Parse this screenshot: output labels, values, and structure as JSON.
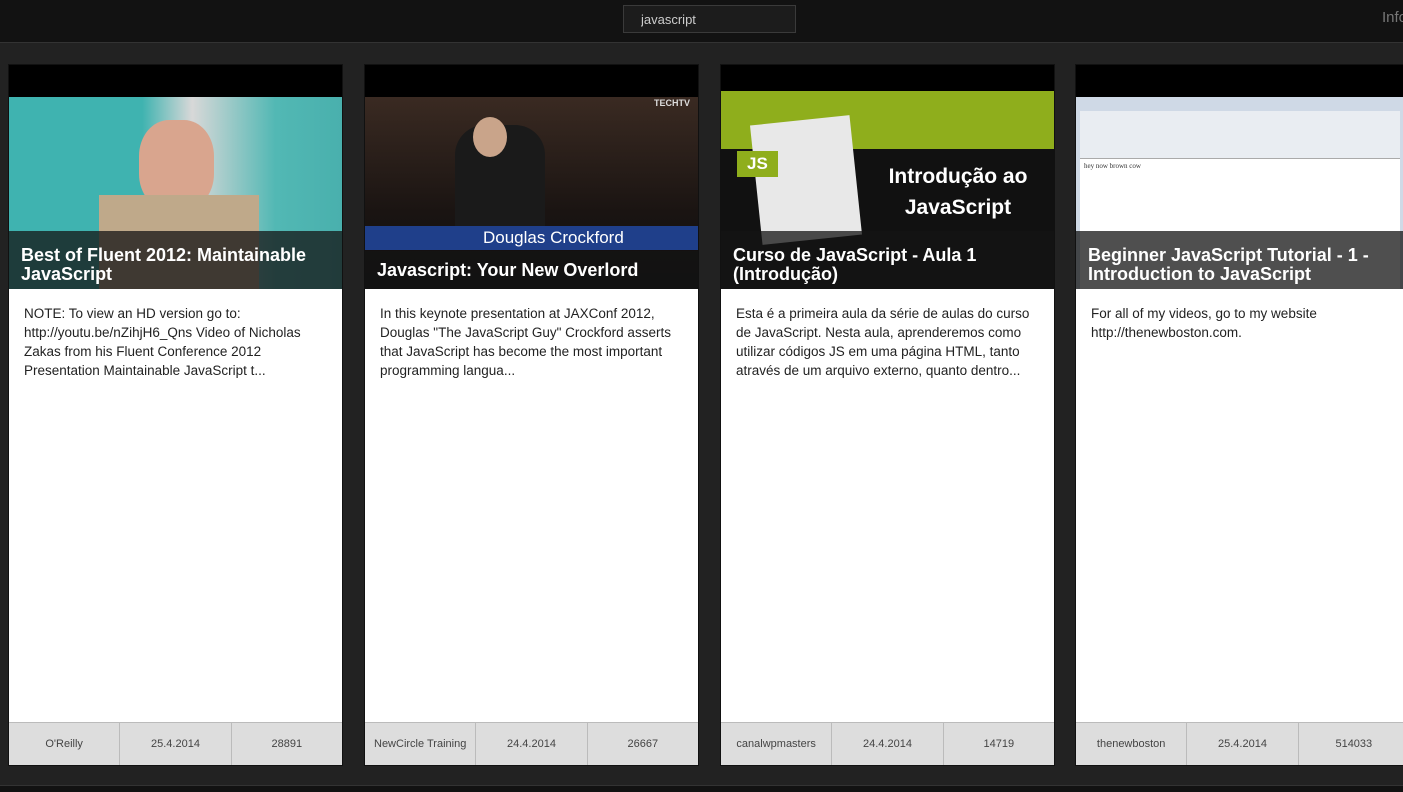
{
  "search": {
    "value": "javascript"
  },
  "header": {
    "info_label": "Info"
  },
  "cards": [
    {
      "title": "Best of Fluent 2012: Maintainable JavaScript",
      "description": "NOTE: To view an HD version go to: http://youtu.be/nZihjH6_Qns Video of Nicholas Zakas from his Fluent Conference 2012 Presentation Maintainable JavaScript t...",
      "channel": "O'Reilly",
      "date": "25.4.2014",
      "views": "28891"
    },
    {
      "title": "Javascript: Your New Overlord",
      "description": "In this keynote presentation at JAXConf 2012, Douglas \"The JavaScript Guy\" Crockford asserts that JavaScript has become the most important programming langua...",
      "channel": "NewCircle Training",
      "date": "24.4.2014",
      "views": "26667",
      "thumb_text": "Douglas Crockford",
      "thumb_logo": "TECHTV"
    },
    {
      "title": "Curso de JavaScript - Aula 1 (Introdução)",
      "description": "Esta é a primeira aula da série de aulas do curso de JavaScript. Nesta aula, aprenderemos como utilizar códigos JS em uma página HTML, tanto através de um arquivo externo, quanto dentro...",
      "channel": "canalwpmasters",
      "date": "24.4.2014",
      "views": "14719",
      "thumb_text": "Introdução ao JavaScript",
      "thumb_badge": "JS"
    },
    {
      "title": "Beginner JavaScript Tutorial - 1 - Introduction to JavaScript",
      "description": "For all of my videos, go to my website http://thenewboston.com.",
      "channel": "thenewboston",
      "date": "25.4.2014",
      "views": "514033",
      "thumb_text": "hey now brown cow"
    }
  ]
}
